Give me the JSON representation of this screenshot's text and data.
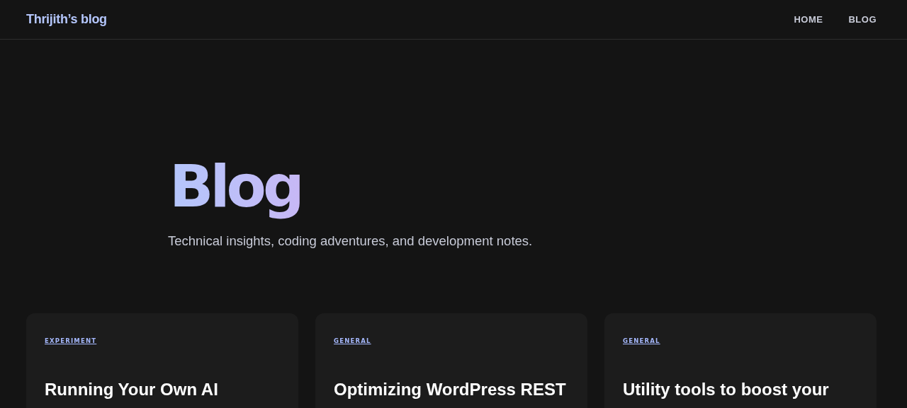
{
  "header": {
    "logo": "Thrijith’s blog",
    "nav": [
      {
        "label": "HOME"
      },
      {
        "label": "BLOG"
      }
    ]
  },
  "hero": {
    "title": "Blog",
    "subtitle": "Technical insights, coding adventures, and development notes."
  },
  "posts": [
    {
      "category": "EXPERIMENT",
      "title": "Running Your Own AI"
    },
    {
      "category": "GENERAL",
      "title": "Optimizing WordPress REST"
    },
    {
      "category": "GENERAL",
      "title": "Utility tools to boost your"
    }
  ]
}
